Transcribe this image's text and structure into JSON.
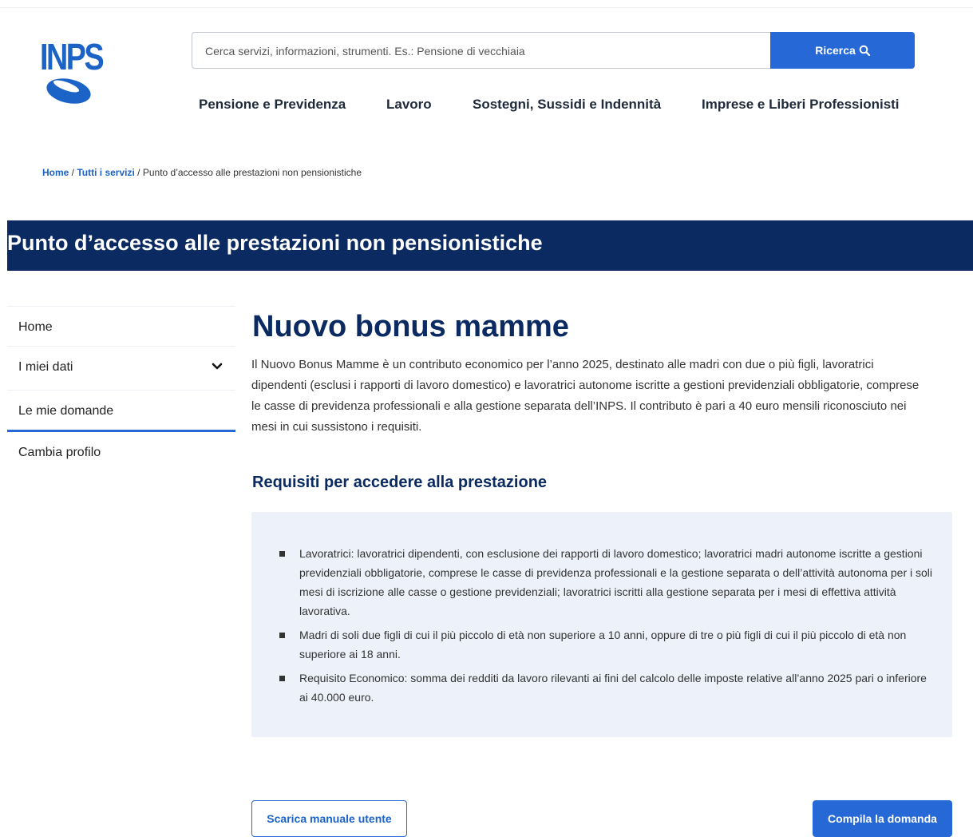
{
  "header": {
    "logo_text": "INPS",
    "search": {
      "placeholder": "Cerca servizi, informazioni, strumenti. Es.: Pensione di vecchiaia",
      "button_label": "Ricerca"
    },
    "nav": [
      {
        "label": "Pensione e Previdenza"
      },
      {
        "label": "Lavoro"
      },
      {
        "label": "Sostegni, Sussidi e Indennità"
      },
      {
        "label": "Imprese e Liberi Professionisti"
      }
    ]
  },
  "breadcrumb": {
    "home": "Home",
    "sep1": " / ",
    "services": "Tutti i servizi",
    "sep2": " / ",
    "current": "Punto d’accesso alle prestazioni non pensionistiche"
  },
  "banner": {
    "title": "Punto d’accesso alle prestazioni non pensionistiche"
  },
  "sidebar": {
    "items": [
      {
        "label": "Home"
      },
      {
        "label": "I miei dati"
      },
      {
        "label": "Le mie domande"
      },
      {
        "label": "Cambia profilo"
      }
    ]
  },
  "main": {
    "title": "Nuovo bonus mamme",
    "intro": "Il Nuovo Bonus Mamme è un contributo economico per l’anno 2025, destinato alle madri con due o più figli, lavoratrici dipendenti (esclusi i rapporti di lavoro domestico) e lavoratrici autonome iscritte a gestioni previdenziali obbligatorie, comprese le casse di previdenza professionali e alla gestione separata dell’INPS. Il contributo è pari a 40 euro mensili riconosciuto nei mesi in cui sussistono i requisiti.",
    "requirements_title": "Requisiti per accedere alla prestazione",
    "requirements": [
      "Lavoratrici: lavoratrici dipendenti, con esclusione dei rapporti di lavoro domestico; lavoratrici madri autonome iscritte a gestioni previdenziali obbligatorie, comprese le casse di previdenza professionali e la gestione separata o dell’attività autonoma per i soli mesi di iscrizione alle casse o gestione previdenziali; lavoratrici iscritti alla gestione separata per i mesi di effettiva attività lavorativa.",
      "Madri di soli due figli di cui il più piccolo di età non superiore a 10 anni, oppure di tre o più figli di cui il più piccolo di età non superiore ai 18 anni.",
      "Requisito Economico: somma dei redditi da lavoro rilevanti ai fini del calcolo delle imposte relative all’anno 2025 pari o inferiore ai 40.000 euro."
    ]
  },
  "actions": {
    "download_manual": "Scarica manuale utente",
    "fill_application": "Compila la domanda"
  },
  "colors": {
    "brand_blue": "#2669d6",
    "navy": "#0a2a61",
    "panel_bg": "#edf1f9"
  }
}
